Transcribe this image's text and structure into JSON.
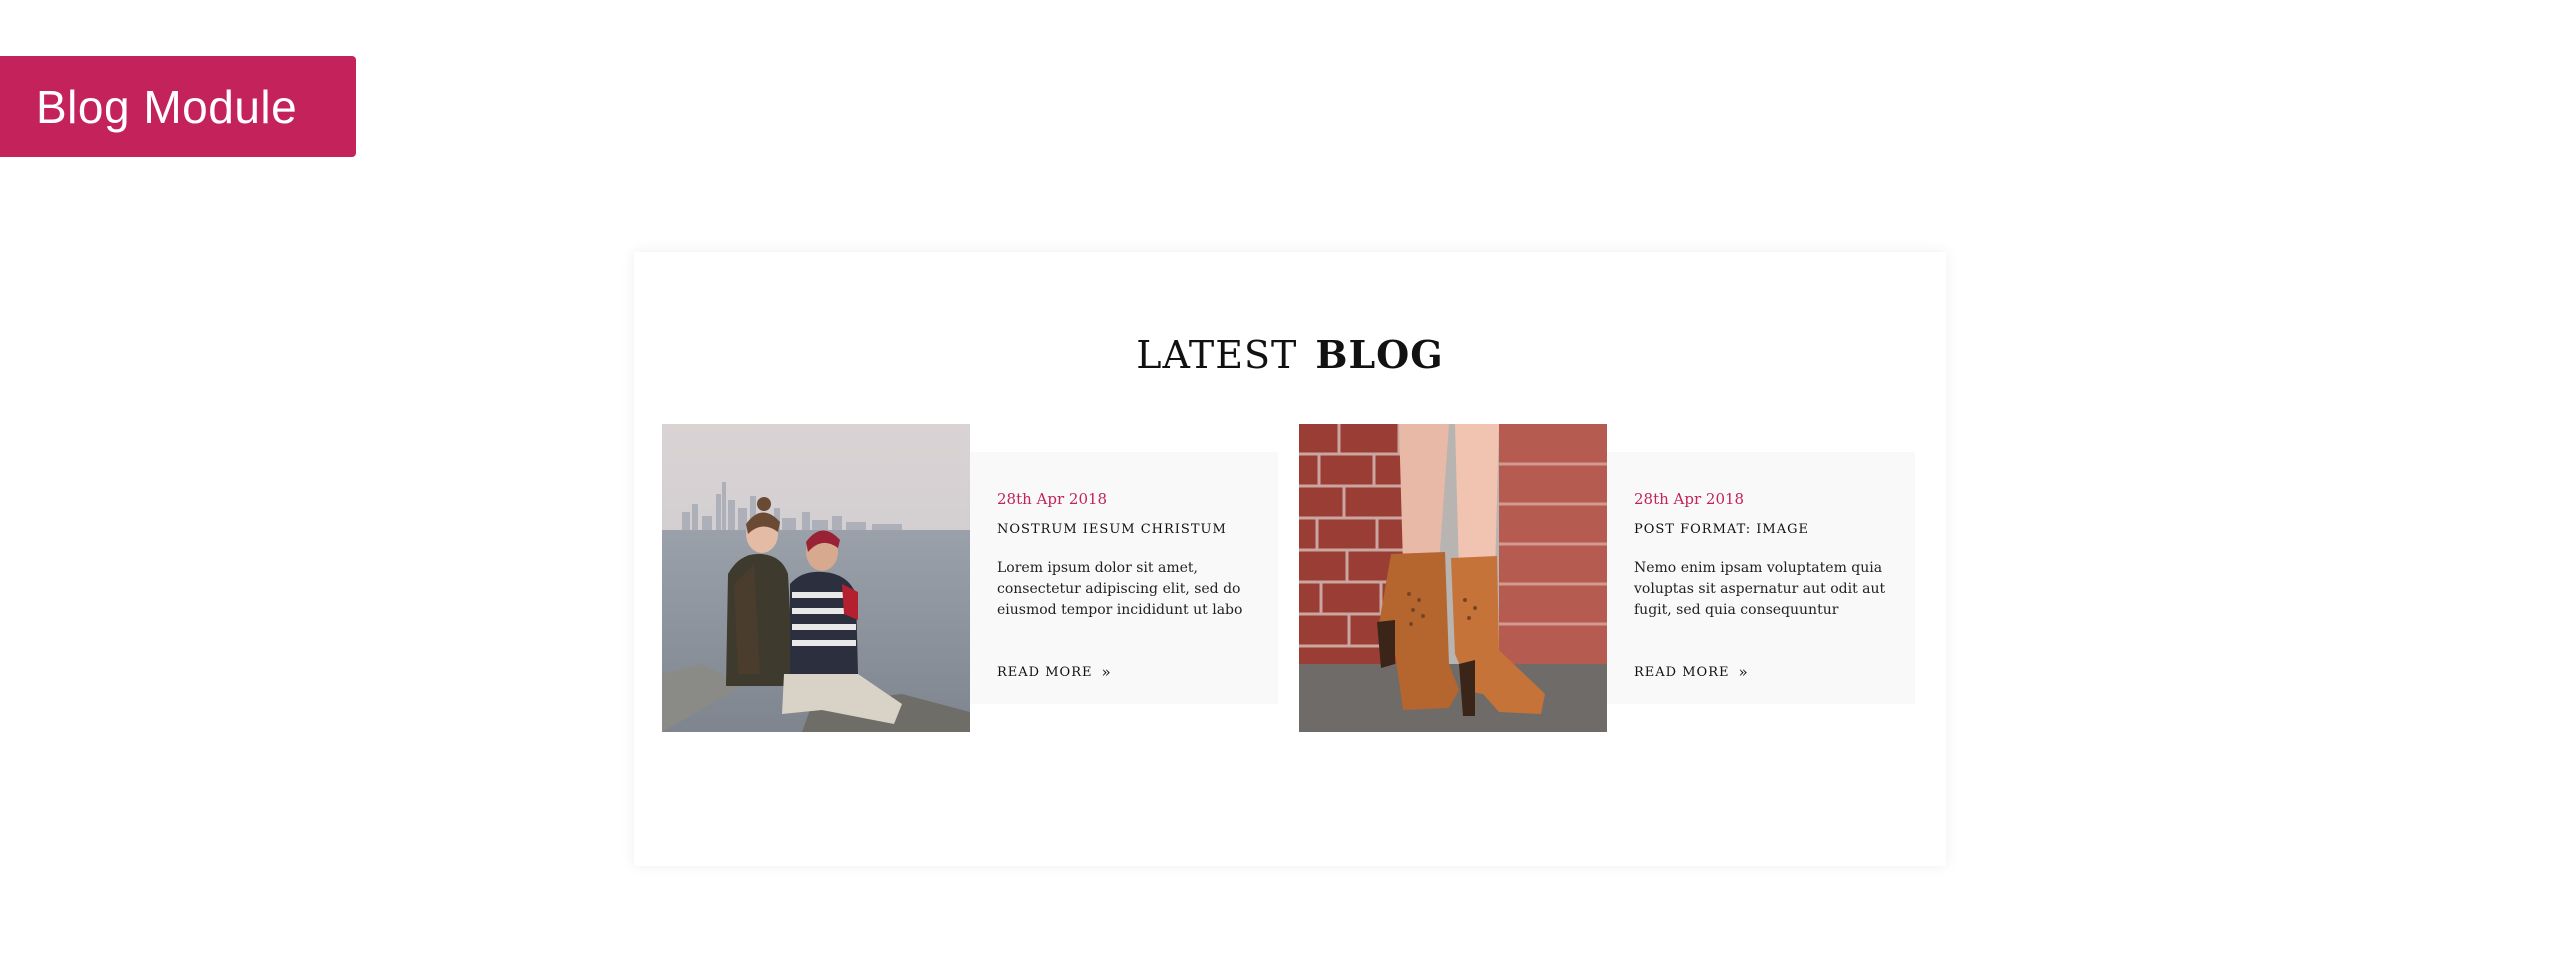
{
  "badge": {
    "label": "Blog Module",
    "color": "#c4225a"
  },
  "section": {
    "heading_light": "LATEST",
    "heading_bold": "BLOG"
  },
  "posts": [
    {
      "date": "28th Apr 2018",
      "title": "NOSTRUM IESUM CHRISTUM",
      "excerpt": "Lorem ipsum dolor sit amet, consectetur adipiscing elit, sed do eiusmod tempor incididunt ut labo",
      "read_more": "READ MORE",
      "read_more_icon": "»",
      "image": "couple-by-lake-photo"
    },
    {
      "date": "28th Apr 2018",
      "title": "POST FORMAT: IMAGE",
      "excerpt": "Nemo enim ipsam voluptatem quia voluptas sit aspernatur aut odit aut fugit, sed quia consequuntur",
      "read_more": "READ MORE",
      "read_more_icon": "»",
      "image": "brown-ankle-boots-photo"
    }
  ],
  "colors": {
    "accent": "#c4225a",
    "text": "#111111",
    "panel": "#f9f9f9"
  }
}
